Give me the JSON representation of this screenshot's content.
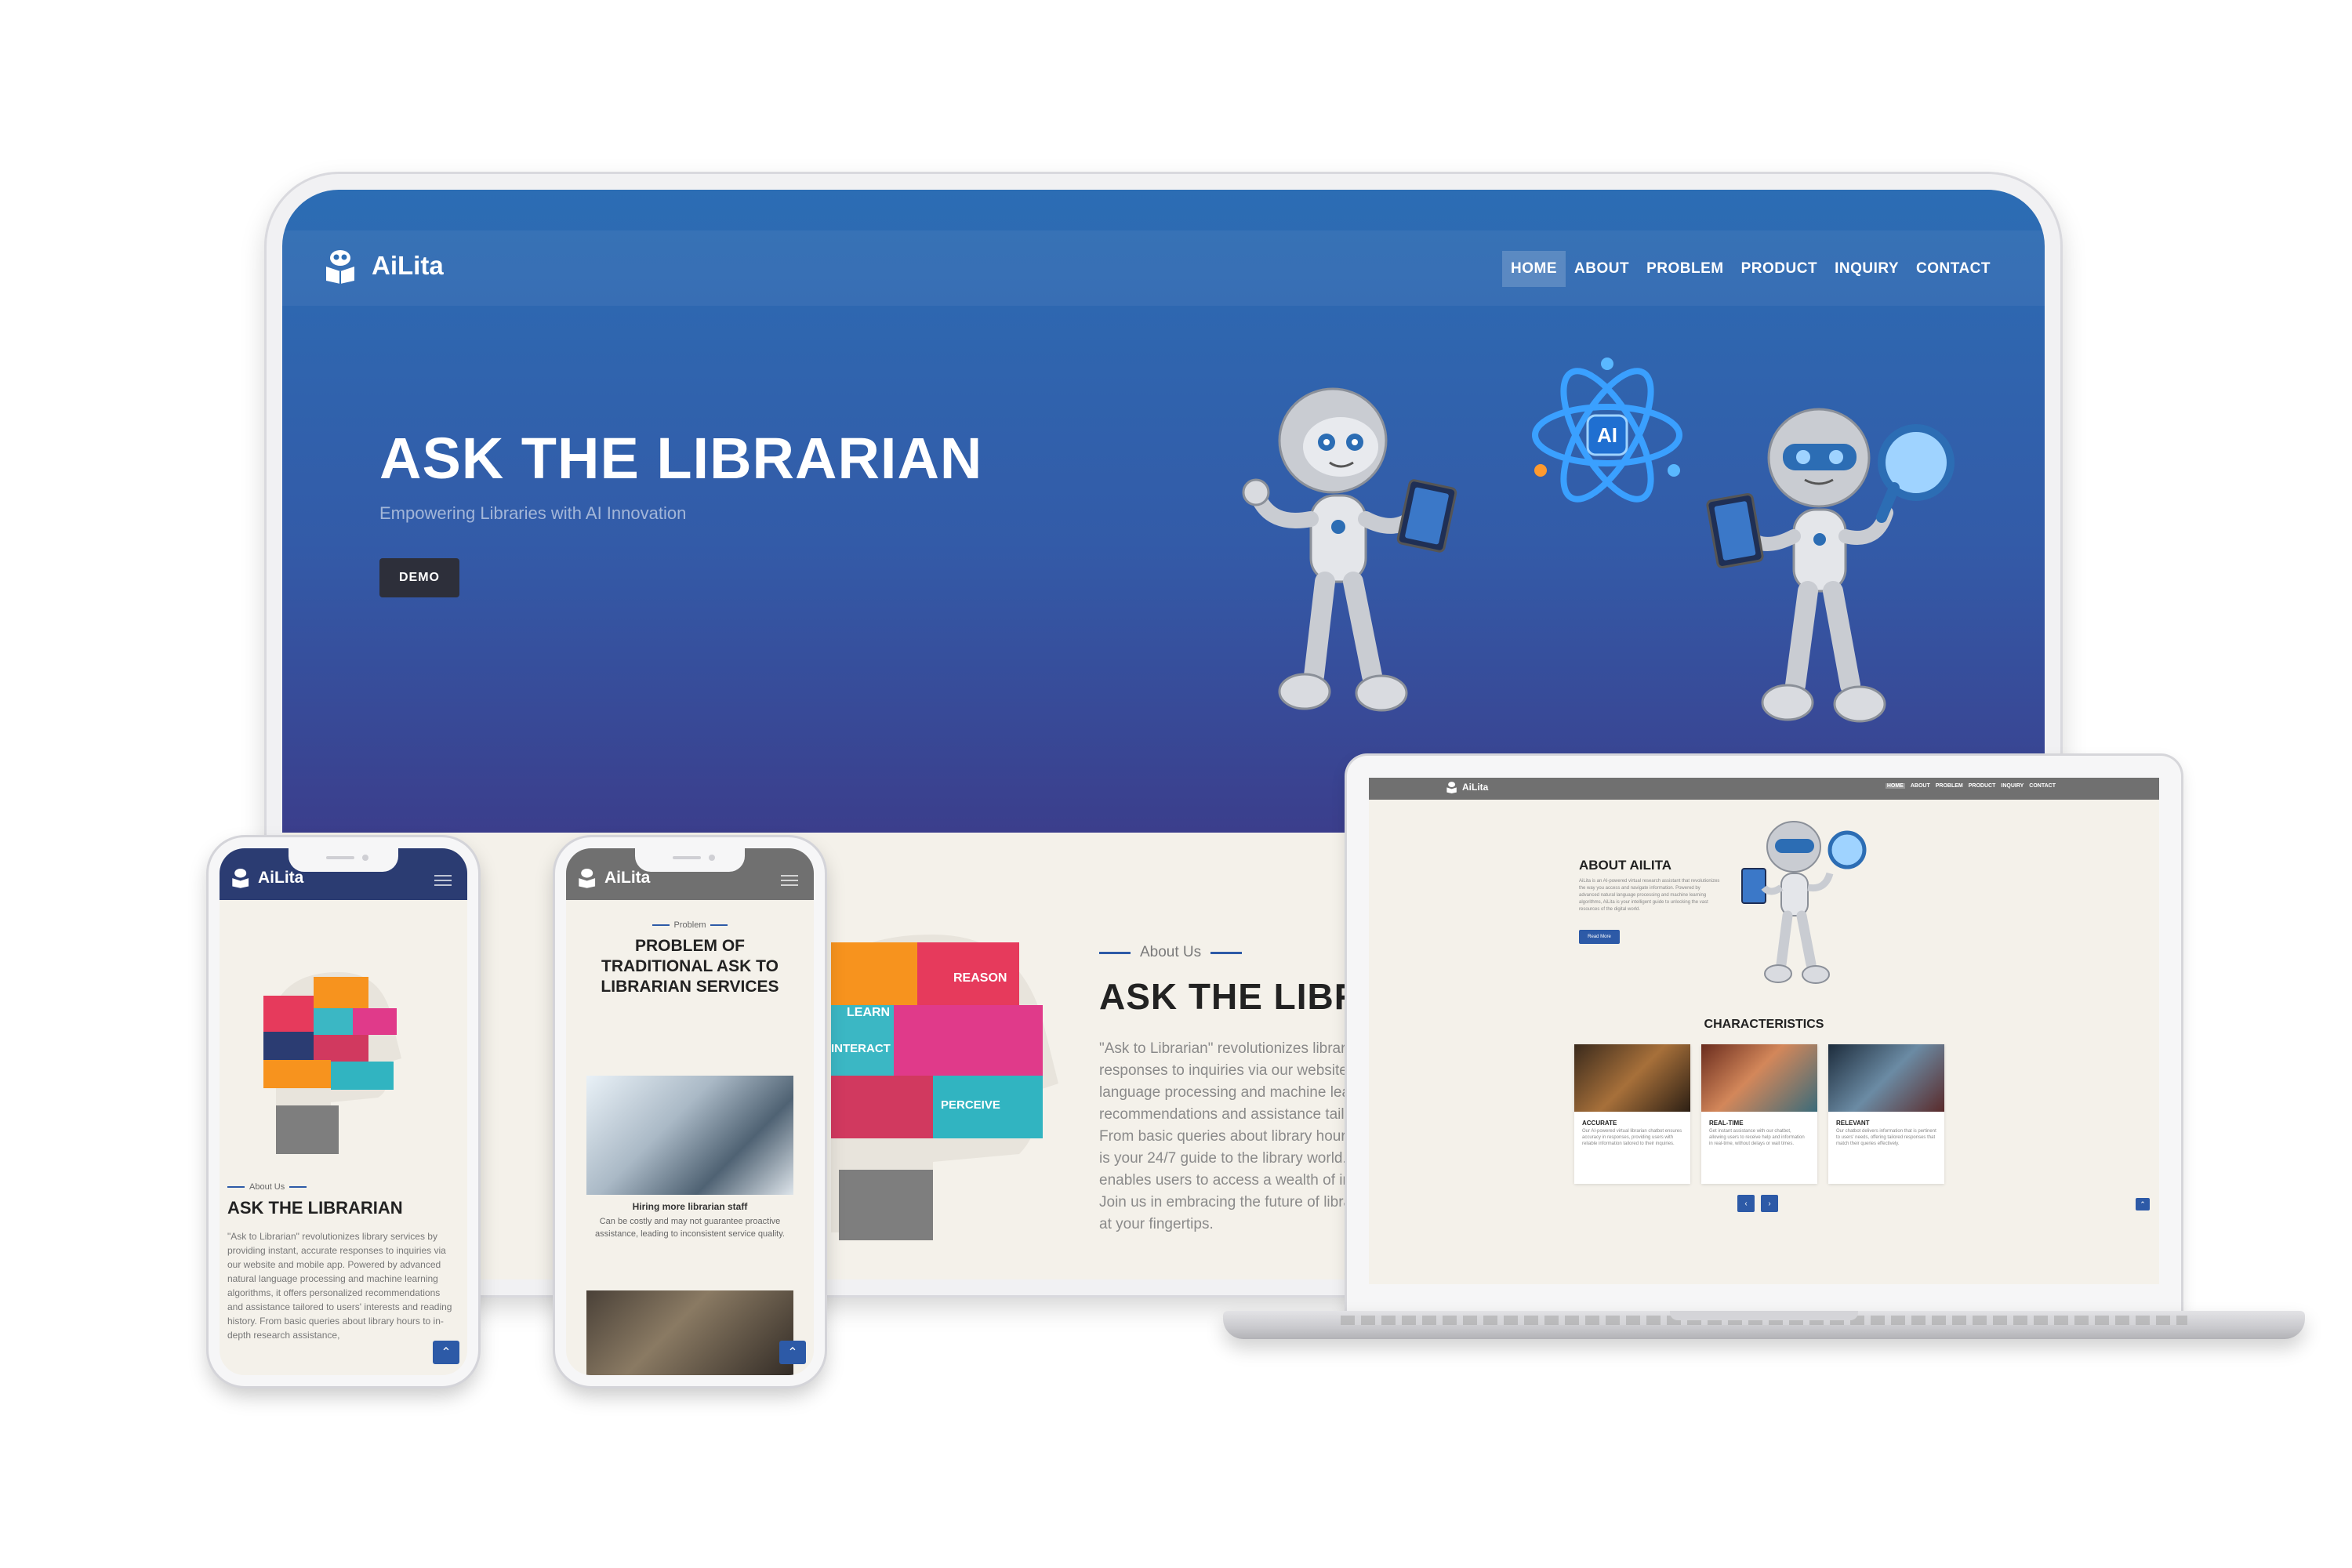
{
  "brand": {
    "name": "AiLita"
  },
  "desktop": {
    "nav": [
      "HOME",
      "ABOUT",
      "PROBLEM",
      "PRODUCT",
      "INQUIRY",
      "CONTACT"
    ],
    "hero_title": "ASK THE LIBRARIAN",
    "hero_subtitle": "Empowering Libraries with AI Innovation",
    "demo_button": "DEMO",
    "atom_label": "AI",
    "about_kicker": "About Us",
    "about_title": "ASK THE LIBRA",
    "about_lines": [
      "\"Ask to Librarian\" revolutionizes library",
      "responses to inquiries via our website a",
      "language processing and machine learn",
      "recommendations and assistance tailo",
      "From basic queries about library hours",
      "is your 24/7 guide to the library world.",
      "enables users to access a wealth of info",
      "Join us in embracing the future of librar",
      "at your fingertips."
    ]
  },
  "head_graphic": {
    "learn": "LEARN",
    "reason": "REASON",
    "interact": "INTERACT",
    "perceive": "PERCEIVE"
  },
  "phone_about": {
    "kicker": "About Us",
    "title": "ASK THE LIBRARIAN",
    "text": "\"Ask to Librarian\" revolutionizes library services by providing instant, accurate responses to inquiries via our website and mobile app. Powered by advanced natural language processing and machine learning algorithms, it offers personalized recommendations and assistance tailored to users' interests and reading history. From basic queries about library hours to in-depth research assistance,"
  },
  "phone_problem": {
    "kicker": "Problem",
    "title_lines": [
      "PROBLEM OF",
      "TRADITIONAL ASK TO",
      "LIBRARIAN SERVICES"
    ],
    "caption_title": "Hiring more librarian staff",
    "caption": "Can be costly and may not guarantee proactive assistance, leading to inconsistent service quality."
  },
  "laptop": {
    "nav": [
      "HOME",
      "ABOUT",
      "PROBLEM",
      "PRODUCT",
      "INQUIRY",
      "CONTACT"
    ],
    "about_title": "ABOUT AILITA",
    "about_text": "AiLita is an AI-powered virtual research assistant that revolutionizes the way you access and navigate information. Powered by advanced natural language processing and machine learning algorithms, AiLita is your intelligent guide to unlocking the vast resources of the digital world.",
    "read_more": "Read More",
    "characteristics_title": "CHARACTERISTICS",
    "cards": [
      {
        "title": "ACCURATE",
        "text": "Our AI-powered virtual librarian chatbot ensures accuracy in responses, providing users with reliable information tailored to their inquiries."
      },
      {
        "title": "REAL-TIME",
        "text": "Get instant assistance with our chatbot, allowing users to receive help and information in real-time, without delays or wait times."
      },
      {
        "title": "RELEVANT",
        "text": "Our chatbot delivers information that is pertinent to users' needs, offering tailored responses that match their queries effectively."
      }
    ]
  },
  "colors": {
    "hero_top": "#2c6db4",
    "hero_bottom": "#3b3e8c",
    "accent": "#2d5aa7",
    "page_bg": "#f4f1ea"
  }
}
